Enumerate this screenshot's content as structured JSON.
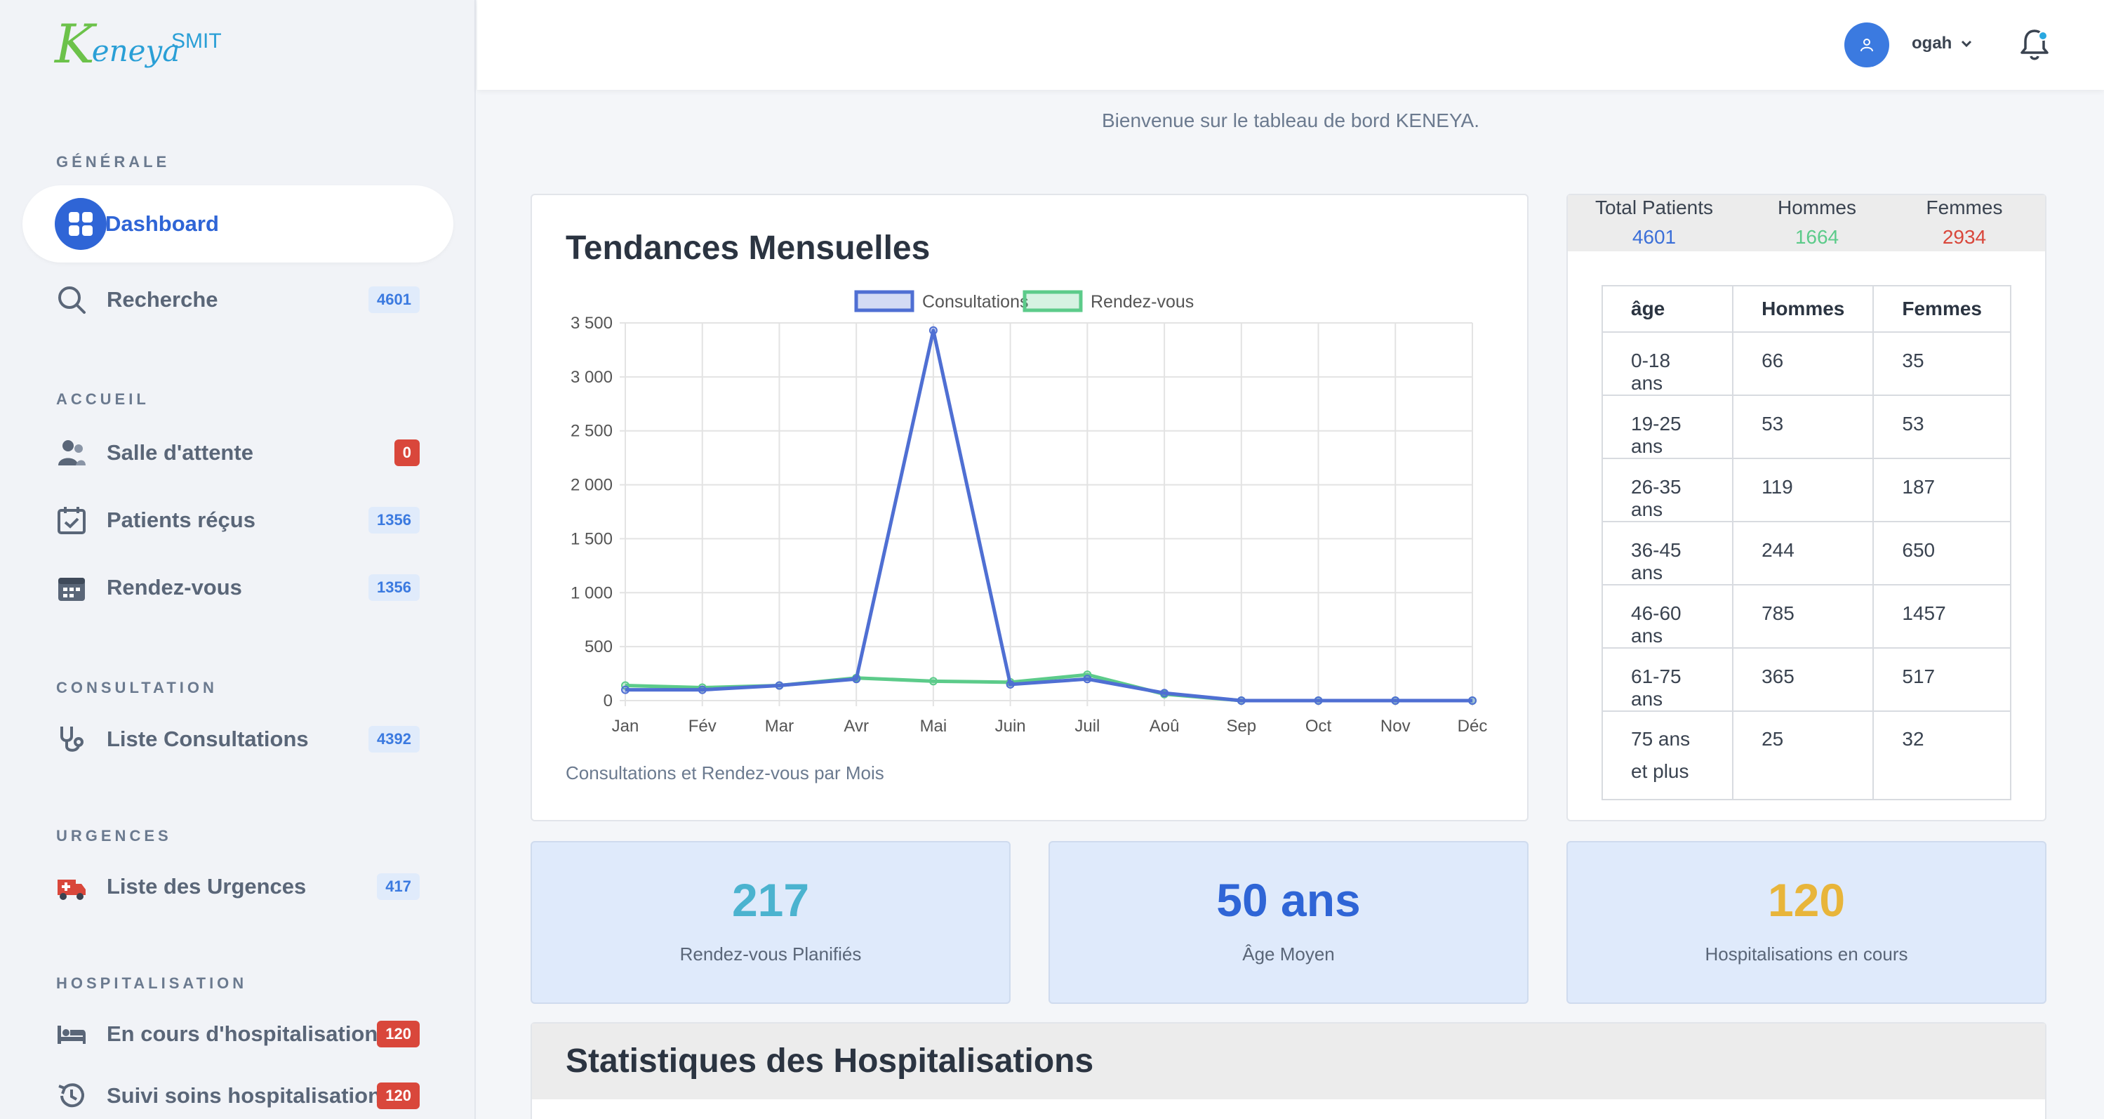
{
  "brand": {
    "logo_k": "K",
    "logo_text": "eneya",
    "suffix": "SMIT"
  },
  "sidebar": {
    "sections": {
      "generale": "GÉNÉRALE",
      "accueil": "ACCUEIL",
      "consultation": "CONSULTATION",
      "urgences": "URGENCES",
      "hospitalisation": "HOSPITALISATION"
    },
    "items": [
      {
        "label": "Dashboard",
        "icon": "dashboard-icon",
        "badge": null,
        "active": true
      },
      {
        "label": "Recherche",
        "icon": "search-icon",
        "badge": "4601"
      },
      {
        "label": "Salle d'attente",
        "icon": "users-icon",
        "badge": "0",
        "badge_color": "red"
      },
      {
        "label": "Patients réçus",
        "icon": "calendar-check-icon",
        "badge": "1356"
      },
      {
        "label": "Rendez-vous",
        "icon": "calendar-icon",
        "badge": "1356"
      },
      {
        "label": "Liste Consultations",
        "icon": "stethoscope-icon",
        "badge": "4392"
      },
      {
        "label": "Liste des Urgences",
        "icon": "ambulance-icon",
        "badge": "417"
      },
      {
        "label": "En cours d'hospitalisation",
        "icon": "bed-icon",
        "badge": "120",
        "badge_color": "red"
      },
      {
        "label": "Suivi soins hospitalisation",
        "icon": "history-icon",
        "badge": "120",
        "badge_color": "red"
      }
    ]
  },
  "header": {
    "username": "ogah",
    "welcome": "Bienvenue sur le tableau de bord KENEYA."
  },
  "chart_card": {
    "title": "Tendances Mensuelles",
    "caption": "Consultations et Rendez-vous par Mois"
  },
  "chart_data": {
    "type": "line",
    "categories": [
      "Jan",
      "Fév",
      "Mar",
      "Avr",
      "Mai",
      "Juin",
      "Juil",
      "Aoû",
      "Sep",
      "Oct",
      "Nov",
      "Déc"
    ],
    "series": [
      {
        "name": "Consultations",
        "color": "#4f6fd3",
        "values": [
          100,
          100,
          140,
          200,
          3430,
          150,
          200,
          70,
          0,
          0,
          0,
          0
        ]
      },
      {
        "name": "Rendez-vous",
        "color": "#5ccb8a",
        "values": [
          140,
          120,
          140,
          210,
          180,
          170,
          240,
          60,
          0,
          0,
          0,
          0
        ]
      }
    ],
    "ylim": [
      0,
      3500
    ],
    "yticks": [
      "0",
      "500",
      "1 000",
      "1 500",
      "2 000",
      "2 500",
      "3 000",
      "3 500"
    ],
    "yticks_values": [
      0,
      500,
      1000,
      1500,
      2000,
      2500,
      3000,
      3500
    ],
    "grid": true,
    "legend": "top-center"
  },
  "stats": {
    "total_label": "Total Patients",
    "total_value": "4601",
    "men_label": "Hommes",
    "men_value": "1664",
    "women_label": "Femmes",
    "women_value": "2934",
    "colors": {
      "total": "#3b6fd8",
      "men": "#5ccb8a",
      "women": "#d9473b"
    }
  },
  "age_table": {
    "headers": [
      "âge",
      "Hommes",
      "Femmes"
    ],
    "rows": [
      [
        "0-18 ans",
        "66",
        "35"
      ],
      [
        "19-25 ans",
        "53",
        "53"
      ],
      [
        "26-35 ans",
        "119",
        "187"
      ],
      [
        "36-45 ans",
        "244",
        "650"
      ],
      [
        "46-60 ans",
        "785",
        "1457"
      ],
      [
        "61-75 ans",
        "365",
        "517"
      ],
      [
        "75 ans et plus",
        "25",
        "32"
      ]
    ]
  },
  "kpis": [
    {
      "value": "217",
      "label": "Rendez-vous Planifiés",
      "color": "#4bb3cf"
    },
    {
      "value": "50 ans",
      "label": "Âge Moyen",
      "color": "#2f65d6"
    },
    {
      "value": "120",
      "label": "Hospitalisations en cours",
      "color": "#e8b53a"
    }
  ],
  "hosp_section": {
    "title": "Statistiques des Hospitalisations"
  }
}
